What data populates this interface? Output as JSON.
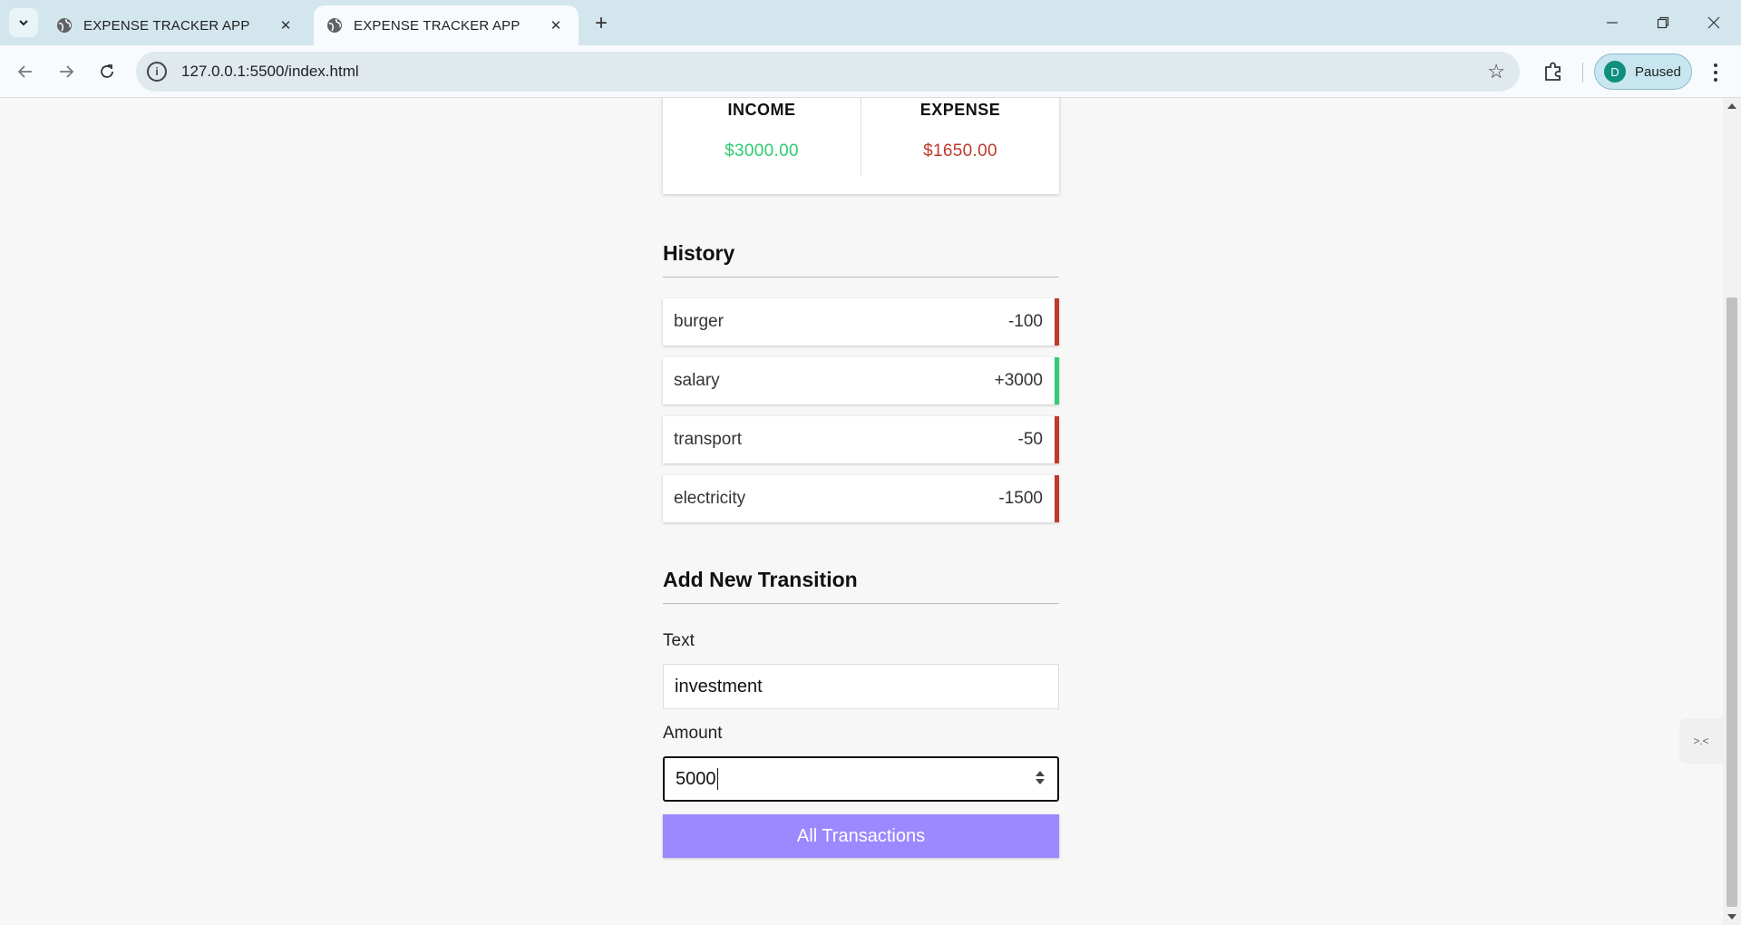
{
  "browser": {
    "tabs": [
      {
        "title": "EXPENSE TRACKER APP",
        "active": false
      },
      {
        "title": "EXPENSE TRACKER APP",
        "active": true
      }
    ],
    "new_tab_symbol": "+",
    "url": "127.0.0.1:5500/index.html",
    "profile": {
      "initial": "D",
      "status": "Paused"
    }
  },
  "summary": {
    "income_label": "INCOME",
    "income_value": "$3000.00",
    "expense_label": "EXPENSE",
    "expense_value": "$1650.00"
  },
  "history": {
    "title": "History",
    "items": [
      {
        "text": "burger",
        "amount": "-100",
        "type": "minus"
      },
      {
        "text": "salary",
        "amount": "+3000",
        "type": "plus"
      },
      {
        "text": "transport",
        "amount": "-50",
        "type": "minus"
      },
      {
        "text": "electricity",
        "amount": "-1500",
        "type": "minus"
      }
    ]
  },
  "form": {
    "title": "Add New Transition",
    "text_label": "Text",
    "text_value": "investment",
    "amount_label": "Amount",
    "amount_value": "5000",
    "submit_label": "All Transactions"
  },
  "colors": {
    "plus": "#2ecc71",
    "minus": "#c0392b",
    "button": "#9c88ff"
  }
}
